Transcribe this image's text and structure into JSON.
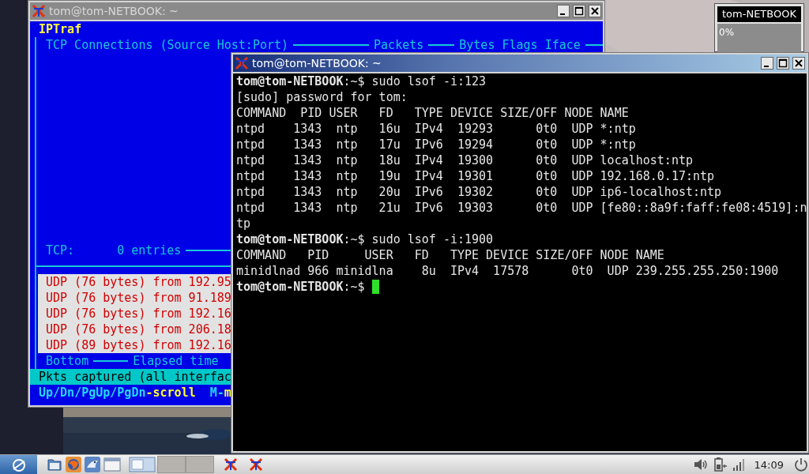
{
  "iptraf_window": {
    "title": "tom@tom-NETBOOK: ~",
    "active": false,
    "app_title": "IPTraf",
    "tcp_panel": {
      "title": "TCP Connections (Source Host:Port)",
      "columns": [
        "Packets",
        "Bytes Flags Iface"
      ],
      "footer_label": "TCP:",
      "footer_count": "0 entries"
    },
    "udp_rows": [
      "UDP (76 bytes) from 192.95",
      "UDP (76 bytes) from 91.189",
      "UDP (76 bytes) from 192.16",
      "UDP (76 bytes) from 206.18",
      "UDP (89 bytes) from 192.16"
    ],
    "udp_footer": {
      "position": "Bottom",
      "elapsed": "Elapsed time"
    },
    "status": "Pkts captured (all interfac",
    "hints": [
      {
        "key": "Up/Dn/PgUp/PgDn",
        "action": "-scroll"
      },
      {
        "key": "M-",
        "action": "m"
      }
    ]
  },
  "terminal_window": {
    "title": "tom@tom-NETBOOK: ~",
    "active": true,
    "lines": [
      {
        "kind": "prompt",
        "text": "**tom@tom-NETBOOK**:~$ sudo lsof -i:123"
      },
      {
        "kind": "output",
        "text": "[sudo] password for tom:"
      },
      {
        "kind": "output",
        "text": "COMMAND  PID USER   FD   TYPE DEVICE SIZE/OFF NODE NAME"
      },
      {
        "kind": "output",
        "text": "ntpd    1343  ntp   16u  IPv4  19293      0t0  UDP *:ntp"
      },
      {
        "kind": "output",
        "text": "ntpd    1343  ntp   17u  IPv6  19294      0t0  UDP *:ntp"
      },
      {
        "kind": "output",
        "text": "ntpd    1343  ntp   18u  IPv4  19300      0t0  UDP localhost:ntp"
      },
      {
        "kind": "output",
        "text": "ntpd    1343  ntp   19u  IPv4  19301      0t0  UDP 192.168.0.17:ntp"
      },
      {
        "kind": "output",
        "text": "ntpd    1343  ntp   20u  IPv6  19302      0t0  UDP ip6-localhost:ntp"
      },
      {
        "kind": "output",
        "text": "ntpd    1343  ntp   21u  IPv6  19303      0t0  UDP [fe80::8a9f:faff:fe08:4519]:n"
      },
      {
        "kind": "output",
        "text": "tp"
      },
      {
        "kind": "prompt",
        "text": "**tom@tom-NETBOOK**:~$ sudo lsof -i:1900"
      },
      {
        "kind": "output",
        "text": "COMMAND   PID     USER   FD   TYPE DEVICE SIZE/OFF NODE NAME"
      },
      {
        "kind": "output",
        "text": "minidlnad 966 minidlna    8u  IPv4  17578      0t0  UDP 239.255.255.250:1900"
      },
      {
        "kind": "prompt",
        "text": "**tom@tom-NETBOOK**:~$",
        "cursor": true
      }
    ]
  },
  "monitor_widget": {
    "title": "tom-NETBOOK",
    "reading": "0%"
  },
  "taskbar": {
    "clock": "14:09"
  }
}
